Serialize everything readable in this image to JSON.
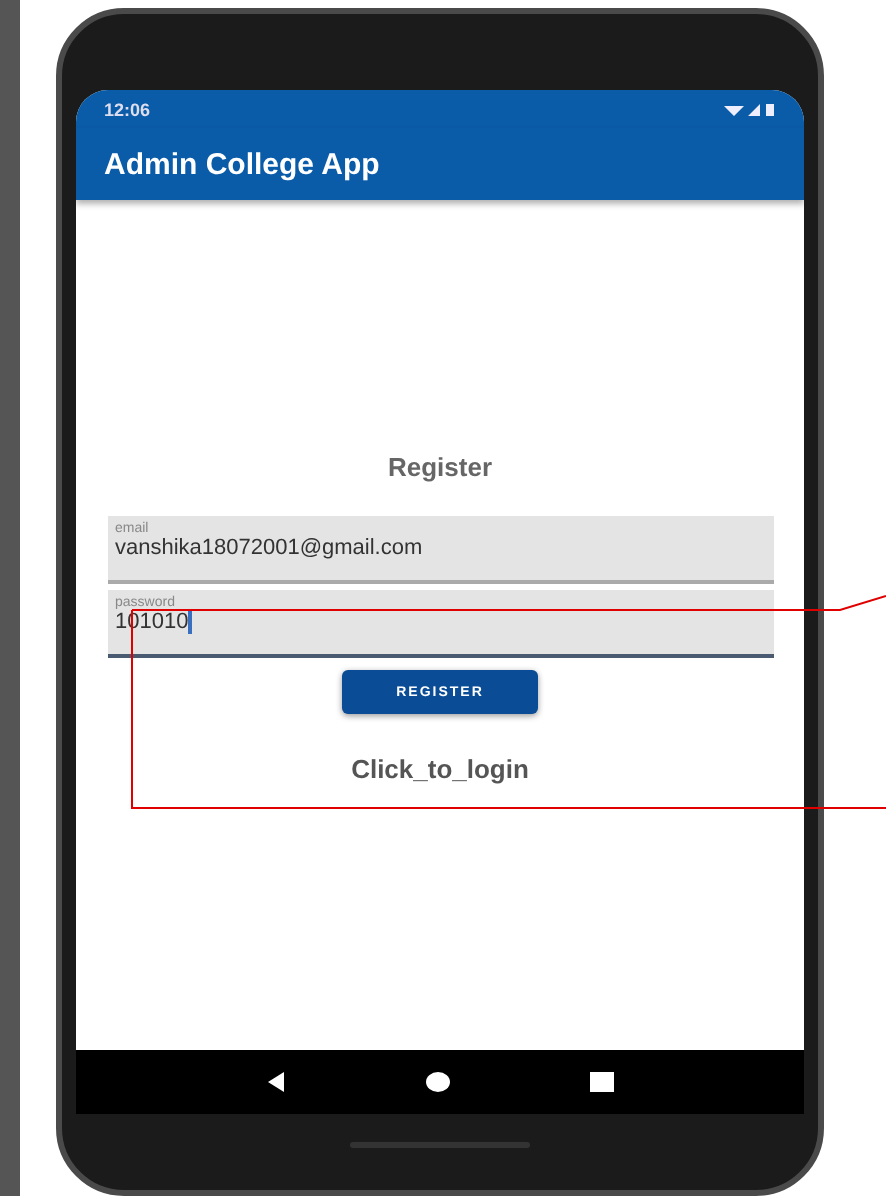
{
  "status_bar": {
    "time": "12:06"
  },
  "app_bar": {
    "title": "Admin College App"
  },
  "form": {
    "heading": "Register",
    "fields": [
      {
        "label": "email",
        "value": "vanshika18072001@gmail.com",
        "focused": false
      },
      {
        "label": "password",
        "value": "101010",
        "focused": true
      }
    ],
    "button": "REGISTER",
    "link": "Click_to_login"
  }
}
